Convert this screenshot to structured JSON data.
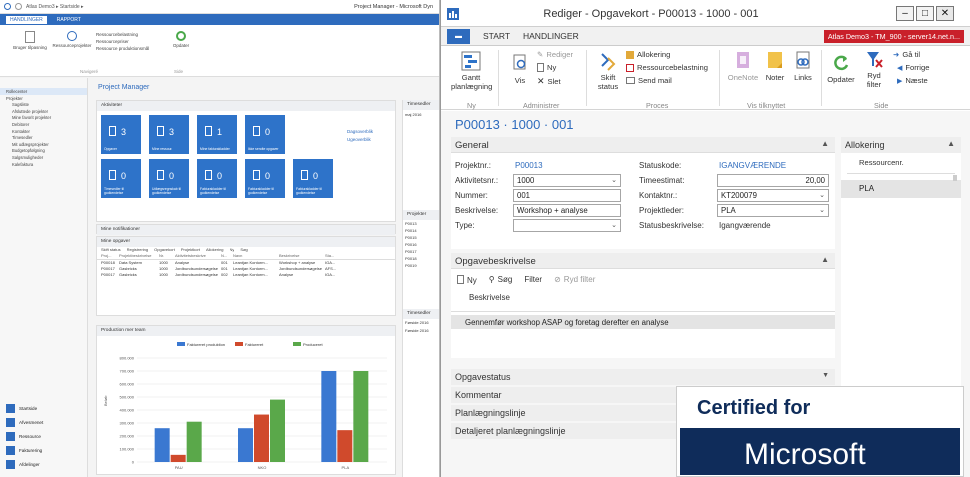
{
  "background_window": {
    "title": "Project Manager - Microsoft Dyn",
    "address": "Atlas Demo3 ▸ Startside ▸",
    "tabs": [
      "HANDLINGER",
      "RAPPORT"
    ],
    "ribbon_items": [
      "Bruger tilpasning",
      "Ressourceprojekter",
      "Ressourcebelastning",
      "Ressourcepriser",
      "Ressource produktionsmål",
      "Opdater"
    ],
    "ribbon_groups": [
      "Navigeré",
      "Side"
    ],
    "nav": {
      "title": "Rollecenter",
      "sections": [
        "Projekter",
        "Sagsliste",
        "Afsluttede projekter",
        "Mine favorit projekter",
        "Debitorer",
        "Kontakter",
        "Timesedler",
        "Mit udlægsprojekter",
        "Budgetopfølgning",
        "Salgsmuligheder",
        "Kalefaktura"
      ],
      "bottom": [
        "Startside",
        "Afvesmenet",
        "Ressource",
        "Fakturering",
        "Afdelinger"
      ]
    },
    "page_title": "Project Manager",
    "activities": {
      "header": "Aktiviteter",
      "tiles_row1": [
        {
          "count": "3",
          "label": "Opgaver"
        },
        {
          "count": "3",
          "label": "Mine ressour."
        },
        {
          "count": "1",
          "label": "Mine fakturakladder"
        },
        {
          "count": "0",
          "label": "Ikke sendte opgaver"
        }
      ],
      "tiles_row2": [
        {
          "count": "0",
          "label": "Timesedler til godkendelse"
        },
        {
          "count": "0",
          "label": "Udlægsregnskab til godkendelse"
        },
        {
          "count": "0",
          "label": "Fakturakladder til godkendelse"
        },
        {
          "count": "0",
          "label": "Fakturakladder til godkendelse"
        },
        {
          "count": "0",
          "label": "Fakturakladder til godkendelse"
        }
      ],
      "links": [
        "Dagsoverblik",
        "Ugeoverblik"
      ]
    },
    "notifications_header": "Mine notifikationer",
    "tasks": {
      "header": "Mine opgaver",
      "toolbar": [
        "Skift status",
        "Registrering",
        "Opgavekort",
        "Projektkort",
        "Allokering",
        "Ny",
        "Søg"
      ],
      "columns": [
        "Proj...",
        "Projektbeskrivelse",
        "Nr.",
        "Aktivitetsbeskrive",
        "N...",
        "Navn",
        "Beskrivelse",
        "Sta..."
      ],
      "rows": [
        [
          "P00018",
          "Data System",
          "1000",
          "Analyse",
          "001",
          "Leantjan Kontorm...",
          "Workshop + analyse",
          "IGA..."
        ],
        [
          "P00017",
          "Gasbricks",
          "1000",
          "Jordbundsundersøgelse",
          "001",
          "Leantjan Kontorm...",
          "Jordbundsundersøgelse",
          "AFS..."
        ],
        [
          "P00017",
          "Gasbricks",
          "1000",
          "Jordbundsundersøgelse",
          "002",
          "Leantjan Kontorm...",
          "Analyse",
          "IGA..."
        ]
      ]
    },
    "right_panel": {
      "header": "Timesedler",
      "projects_header": "Projekter",
      "project_codes": [
        "P0013",
        "P0014",
        "P0015",
        "P0016",
        "P0017",
        "P0018",
        "P0019"
      ],
      "date_label": "maj 2016",
      "bottom_header": "Timesedler",
      "bottom_rows": [
        "Førside 2016",
        "Førside 2016"
      ]
    },
    "chart_panel_header": "Production mer team",
    "chart_data": {
      "type": "bar",
      "categories": [
        "PAU",
        "NKO",
        "PLA"
      ],
      "series": [
        {
          "name": "Faktureret produktion",
          "values": [
            260000,
            260000,
            700000
          ]
        },
        {
          "name": "Faktureret",
          "values": [
            55000,
            365000,
            245000
          ]
        },
        {
          "name": "Produceret",
          "values": [
            310000,
            480000,
            700000
          ]
        }
      ],
      "ylabel": "Beløb",
      "yticks": [
        "0",
        "100.000",
        "200.000",
        "300.000",
        "400.000",
        "500.000",
        "600.000",
        "700.000",
        "800.000"
      ],
      "ylim": [
        0,
        800000
      ],
      "colors": [
        "#3a78d1",
        "#d04a2c",
        "#5aa84a"
      ]
    }
  },
  "window": {
    "title": "Rediger - Opgavekort - P00013 - 1000 - 001",
    "controls": {
      "minimize": "–",
      "maximize": "□",
      "close": "✕"
    },
    "menu_label": "▬",
    "tabs": [
      "START",
      "HANDLINGER"
    ],
    "environment": "Atlas Demo3 - TM_900 - server14.net.n..."
  },
  "ribbon": {
    "items": {
      "gantt": "Gantt planlægning",
      "vis": "Vis",
      "rediger": "Rediger",
      "ny": "Ny",
      "slet": "Slet",
      "skift_status": "Skift status",
      "allokering": "Allokering",
      "ressourcebelastning": "Ressourcebelastning",
      "send_mail": "Send mail",
      "onenote": "OneNote",
      "noter": "Noter",
      "links": "Links",
      "opdater": "Opdater",
      "ryd_filter": "Ryd filter",
      "ga_til": "Gå til",
      "forrige": "Forrige",
      "naeste": "Næste"
    },
    "groups": {
      "ny": "Ny",
      "administrer": "Administrer",
      "proces": "Proces",
      "vis_tilknyttet": "Vis tilknyttet",
      "side": "Side"
    }
  },
  "record_title": "P00013 · 1000 · 001",
  "general": {
    "header": "General",
    "fields_left": [
      {
        "label": "Projektnr.:",
        "value": "P00013"
      },
      {
        "label": "Aktivitetsnr.:",
        "value": "1000"
      },
      {
        "label": "Nummer:",
        "value": "001"
      },
      {
        "label": "Beskrivelse:",
        "value": "Workshop + analyse"
      },
      {
        "label": "Type:",
        "value": ""
      }
    ],
    "fields_right": [
      {
        "label": "Statuskode:",
        "value": "IGANGVÆRENDE"
      },
      {
        "label": "Timeestimat:",
        "value": "20,00"
      },
      {
        "label": "Kontaktnr.:",
        "value": "KT200079"
      },
      {
        "label": "Projektleder:",
        "value": "PLA"
      },
      {
        "label": "Statusbeskrivelse:",
        "value": "Igangværende"
      }
    ]
  },
  "opgavebeskrivelse": {
    "header": "Opgavebeskrivelse",
    "toolbar": {
      "ny": "Ny",
      "sog": "Søg",
      "filter": "Filter",
      "ryd_filter": "Ryd filter"
    },
    "column": "Beskrivelse",
    "rows": [
      "Gennemfør workshop ASAP og foretag derefter en analyse"
    ]
  },
  "collapsed_sections": [
    "Opgavestatus",
    "Kommentar",
    "Planlægningslinje",
    "Detaljeret planlægningslinje"
  ],
  "factbox": {
    "header": "Allokering",
    "column": "Ressourcenr.",
    "rows": [
      "PLA"
    ]
  },
  "certification": {
    "line1": "Certified for",
    "line2": "Microsoft"
  }
}
